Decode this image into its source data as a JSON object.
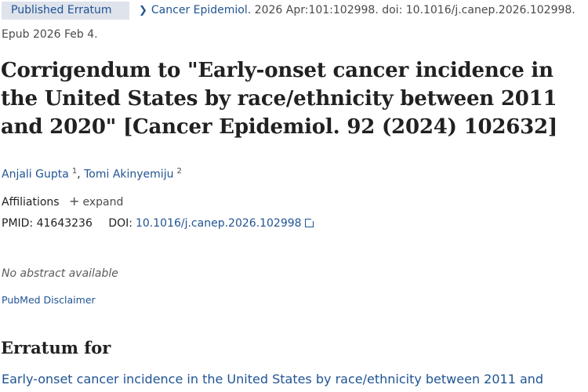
{
  "badge": "Published Erratum",
  "citation": {
    "journal": "Cancer Epidemiol.",
    "rest": "2026 Apr:101:102998. doi: 10.1016/j.canep.2026.102998.",
    "epub": "Epub 2026 Feb 4."
  },
  "title": "Corrigendum to \"Early-onset cancer incidence in the United States by race/ethnicity between 2011 and 2020\" [Cancer Epidemiol. 92 (2024) 102632]",
  "authors": [
    {
      "name": "Anjali Gupta",
      "aff": "1"
    },
    {
      "name": "Tomi Akinyemiju",
      "aff": "2"
    }
  ],
  "affiliations": {
    "label": "Affiliations",
    "expand": "expand"
  },
  "ids": {
    "pmid_label": "PMID:",
    "pmid": "41643236",
    "doi_label": "DOI:",
    "doi": "10.1016/j.canep.2026.102998"
  },
  "no_abstract": "No abstract available",
  "disclaimer": "PubMed Disclaimer",
  "erratum_heading": "Erratum for",
  "erratum_link": "Early-onset cancer incidence in the United States by race/ethnicity between 2011 and"
}
